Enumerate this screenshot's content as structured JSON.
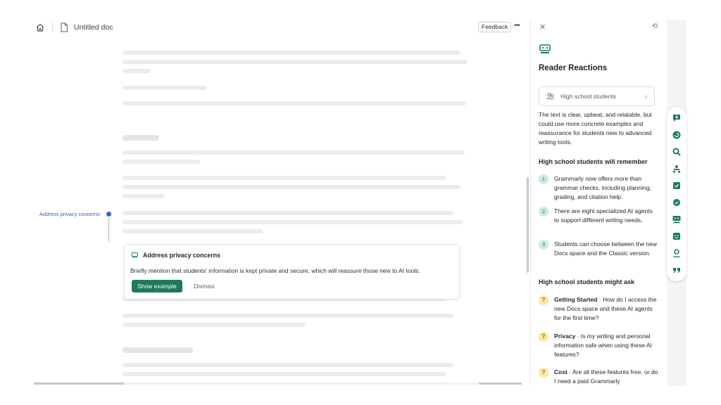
{
  "topbar": {
    "doc_title": "Untitled doc",
    "feedback_label": "Feedback",
    "more_label": "•••"
  },
  "marker": {
    "label": "Address privacy concerns"
  },
  "suggestion_card": {
    "title": "Address privacy concerns",
    "body": "Briefly mention that students' information is kept private and secure, which will reassure those new to AI tools.",
    "show_example_label": "Show example",
    "dismiss_label": "Dismiss"
  },
  "panel": {
    "close_label": "✕",
    "refresh_label": "⟲",
    "title": "Reader Reactions",
    "audience": "High school students",
    "summary": "The text is clear, upbeat, and relatable, but could use more concrete examples and reassurance for students new to advanced writing tools.",
    "remember_heading": "High school students will remember",
    "remember_items": [
      {
        "num": "1",
        "text": "Grammarly now offers more than grammar checks, including planning, grading, and citation help."
      },
      {
        "num": "2",
        "text": "There are eight specialized AI agents to support different writing needs."
      },
      {
        "num": "3",
        "text": "Students can choose between the new Docs space and the Classic version."
      }
    ],
    "ask_heading": "High school students might ask",
    "ask_items": [
      {
        "mark": "?",
        "topic": "Getting Started",
        "text": " · How do I access the new Docs space and these AI agents for the first time?"
      },
      {
        "mark": "?",
        "topic": "Privacy",
        "text": " · Is my writing and personal information safe when using these AI features?"
      },
      {
        "mark": "?",
        "topic": "Cost",
        "text": " · Are all these features free, or do I need a paid Grammarly"
      }
    ]
  },
  "rail_icons": [
    "comment-plus-icon",
    "refresh-circle-icon",
    "magnifier-icon",
    "people-icon",
    "image-check-icon",
    "badge-check-icon",
    "reader-reactions-icon",
    "smile-face-icon",
    "person-pin-icon",
    "quote-icon"
  ],
  "colors": {
    "accent_green": "#1f7a5c",
    "marker_blue": "#3366dd"
  }
}
